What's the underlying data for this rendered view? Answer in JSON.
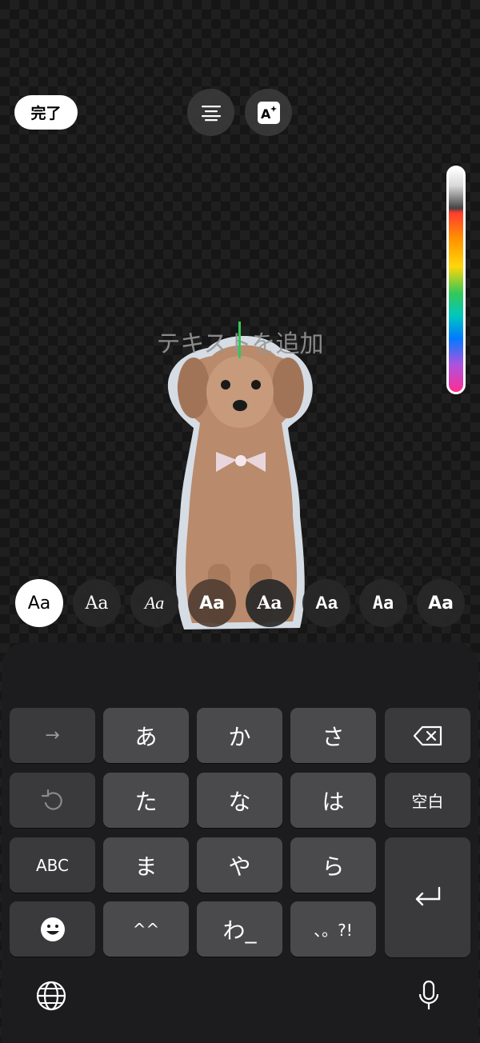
{
  "toolbar": {
    "done_label": "完了",
    "align_icon": "text-align-center-icon",
    "effect_icon": "text-effect-icon"
  },
  "color_slider": {
    "icon": "color-gradient-slider"
  },
  "editor": {
    "placeholder": "テキストを追加"
  },
  "font_styles": [
    {
      "label": "Aa",
      "selected": true
    },
    {
      "label": "Aa",
      "selected": false
    },
    {
      "label": "Aa",
      "selected": false
    },
    {
      "label": "Aa",
      "selected": false
    },
    {
      "label": "Aa",
      "selected": false
    },
    {
      "label": "Aa",
      "selected": false
    },
    {
      "label": "Aa",
      "selected": false
    },
    {
      "label": "Aa",
      "selected": false
    }
  ],
  "keyboard": {
    "row1": [
      "→",
      "あ",
      "か",
      "さ",
      "⌫"
    ],
    "row2": [
      "↺",
      "た",
      "な",
      "は",
      "空白"
    ],
    "row3": [
      "ABC",
      "ま",
      "や",
      "ら",
      "⏎"
    ],
    "row4": [
      "☺",
      "^^",
      "わ_",
      "、。?!"
    ],
    "globe_icon": "globe-icon",
    "mic_icon": "microphone-icon"
  },
  "colors": {
    "accent_cursor": "#34c759",
    "key_bg": "#4a4a4c",
    "key_func_bg": "#3a3a3c",
    "keyboard_bg": "#1c1c1e"
  }
}
